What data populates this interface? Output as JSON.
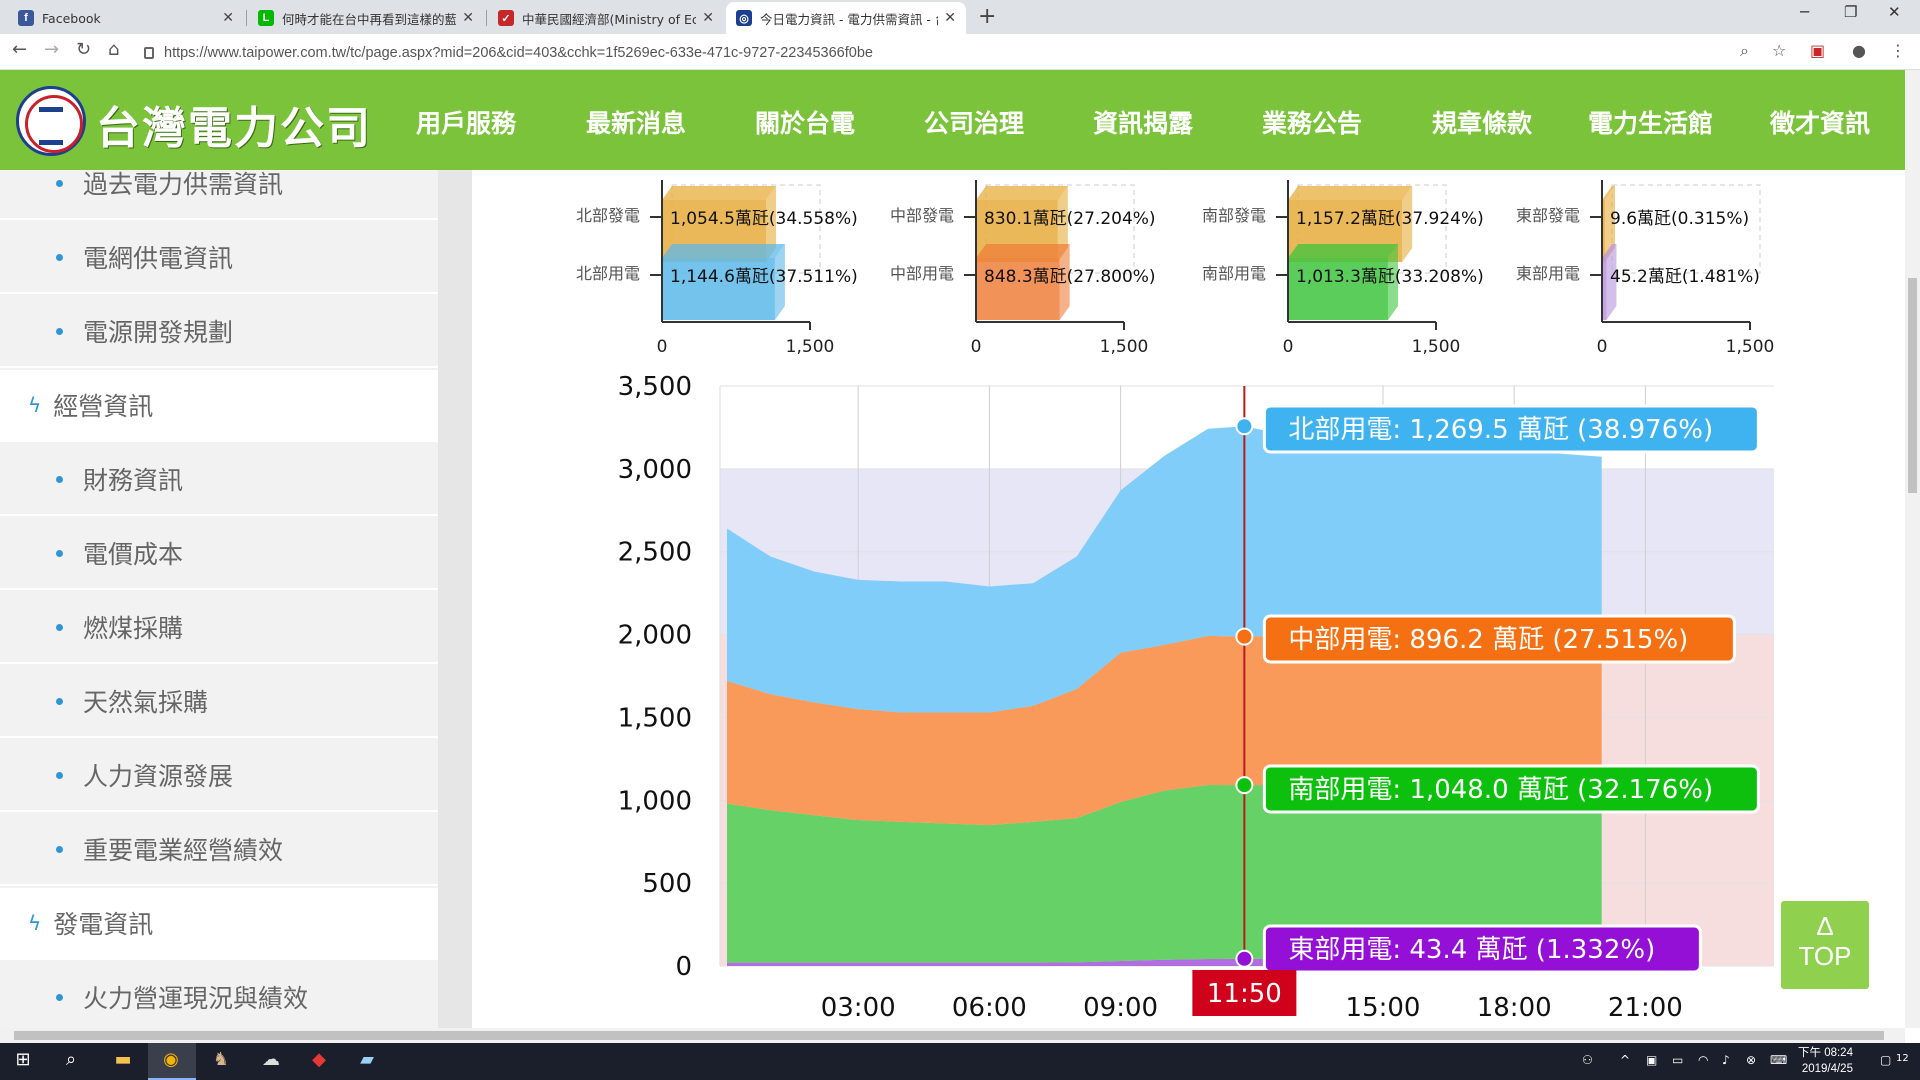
{
  "browser": {
    "tabs": [
      {
        "title": "Facebook",
        "favicon": "facebook-icon",
        "color": "#3b5998",
        "glyph": "f",
        "active": false
      },
      {
        "title": "何時才能在台中再看到這樣的藍天",
        "favicon": "line-icon",
        "color": "#00b900",
        "glyph": "L",
        "active": false
      },
      {
        "title": "中華民國經濟部(Ministry of Econ",
        "favicon": "ministry-icon",
        "color": "#c62828",
        "glyph": "✓",
        "active": false
      },
      {
        "title": "今日電力資訊 - 電力供需資訊 - 台",
        "favicon": "taipower-icon",
        "color": "#1c3f8e",
        "glyph": "◎",
        "active": true
      }
    ],
    "url": "https://www.taipower.com.tw/tc/page.aspx?mid=206&cid=403&cchk=1f5269ec-633e-471c-9727-22345366f0be"
  },
  "site": {
    "logo_text": "台灣電力公司",
    "nav": [
      "用戶服務",
      "最新消息",
      "關於台電",
      "公司治理",
      "資訊揭露",
      "業務公告",
      "規章條款",
      "電力生活館",
      "徵才資訊"
    ],
    "active_nav": "資訊揭露"
  },
  "sidebar": {
    "items": [
      {
        "type": "sub",
        "label": "過去電力供需資訊"
      },
      {
        "type": "sub",
        "label": "電網供電資訊"
      },
      {
        "type": "sub",
        "label": "電源開發規劃"
      },
      {
        "type": "cat",
        "label": "經營資訊"
      },
      {
        "type": "sub",
        "label": "財務資訊"
      },
      {
        "type": "sub",
        "label": "電價成本"
      },
      {
        "type": "sub",
        "label": "燃煤採購"
      },
      {
        "type": "sub",
        "label": "天然氣採購"
      },
      {
        "type": "sub",
        "label": "人力資源發展"
      },
      {
        "type": "sub",
        "label": "重要電業經營績效"
      },
      {
        "type": "cat",
        "label": "發電資訊"
      },
      {
        "type": "sub",
        "label": "火力營運現況與績效"
      }
    ]
  },
  "top_button": {
    "arrow": "Δ",
    "label": "TOP"
  },
  "taskbar": {
    "clock_time": "下午 08:24",
    "clock_date": "2019/4/25",
    "notifications": "12"
  },
  "chart_data": [
    {
      "type": "bar",
      "unit": "萬瓩",
      "xlim": [
        0,
        1500
      ],
      "x_ticks": [
        "0",
        "1,500"
      ],
      "groups": [
        {
          "region": "北部",
          "bars": [
            {
              "label": "北部發電",
              "value": 1054.5,
              "text": "1,054.5",
              "pct": "34.558%",
              "color": "#e8ac3c"
            },
            {
              "label": "北部用電",
              "value": 1144.6,
              "text": "1,144.6",
              "pct": "37.511%",
              "color": "#5cb8ea"
            }
          ]
        },
        {
          "region": "中部",
          "bars": [
            {
              "label": "中部發電",
              "value": 830.1,
              "text": "830.1",
              "pct": "27.204%",
              "color": "#e8ac3c"
            },
            {
              "label": "中部用電",
              "value": 848.3,
              "text": "848.3",
              "pct": "27.800%",
              "color": "#ee7f3b"
            }
          ]
        },
        {
          "region": "南部",
          "bars": [
            {
              "label": "南部發電",
              "value": 1157.2,
              "text": "1,157.2",
              "pct": "37.924%",
              "color": "#e8ac3c"
            },
            {
              "label": "南部用電",
              "value": 1013.3,
              "text": "1,013.3",
              "pct": "33.208%",
              "color": "#3ec43e"
            }
          ]
        },
        {
          "region": "東部",
          "bars": [
            {
              "label": "東部發電",
              "value": 9.6,
              "text": "9.6",
              "pct": "0.315%",
              "color": "#e8ac3c"
            },
            {
              "label": "東部用電",
              "value": 45.2,
              "text": "45.2",
              "pct": "1.481%",
              "color": "#b894dc"
            }
          ]
        }
      ]
    },
    {
      "type": "area",
      "stacked": true,
      "ylim": [
        0,
        3500
      ],
      "y_ticks": [
        "0",
        "500",
        "1,000",
        "1,500",
        "2,000",
        "2,500",
        "3,000",
        "3,500"
      ],
      "x_ticks": [
        "03:00",
        "06:00",
        "09:00",
        "15:00",
        "18:00",
        "21:00"
      ],
      "current_time": "11:50",
      "x_hours": [
        0,
        1,
        2,
        3,
        4,
        5,
        6,
        7,
        8,
        9,
        10,
        11,
        11.83,
        13,
        14,
        15,
        16,
        17,
        18,
        19,
        20
      ],
      "series": [
        {
          "name": "東部用電",
          "color": "#b16ee0",
          "values": [
            20,
            20,
            20,
            20,
            20,
            20,
            20,
            20,
            22,
            30,
            38,
            42,
            43.4,
            43,
            43,
            43,
            43,
            43,
            43,
            43,
            43
          ]
        },
        {
          "name": "南部用電",
          "color": "#66d166",
          "values": [
            960,
            920,
            890,
            860,
            850,
            840,
            830,
            850,
            870,
            960,
            1020,
            1050,
            1048.0,
            1050,
            1050,
            1050,
            1050,
            1050,
            1050,
            1050,
            1050
          ]
        },
        {
          "name": "中部用電",
          "color": "#fa9a5a",
          "values": [
            740,
            700,
            680,
            670,
            660,
            670,
            680,
            700,
            780,
            900,
            880,
            900,
            896.2,
            900,
            900,
            900,
            900,
            900,
            900,
            900,
            900
          ]
        },
        {
          "name": "北部用電",
          "color": "#7fcdf8",
          "values": [
            920,
            830,
            790,
            780,
            790,
            790,
            760,
            740,
            800,
            980,
            1140,
            1250,
            1269.5,
            1200,
            1150,
            1120,
            1100,
            1100,
            1100,
            1100,
            1080
          ]
        }
      ],
      "tooltips": [
        {
          "text": "北部用電: 1,269.5 萬瓩 (38.976%)",
          "color": "#3fb3f0"
        },
        {
          "text": "中部用電: 896.2 萬瓩 (27.515%)",
          "color": "#f57012"
        },
        {
          "text": "南部用電: 1,048.0 萬瓩 (32.176%)",
          "color": "#0ec00e"
        },
        {
          "text": "東部用電: 43.4 萬瓩 (1.332%)",
          "color": "#9410d6"
        }
      ],
      "band_colors": {
        "upper": "#e6e6f7",
        "lower": "#f6dede"
      }
    }
  ]
}
